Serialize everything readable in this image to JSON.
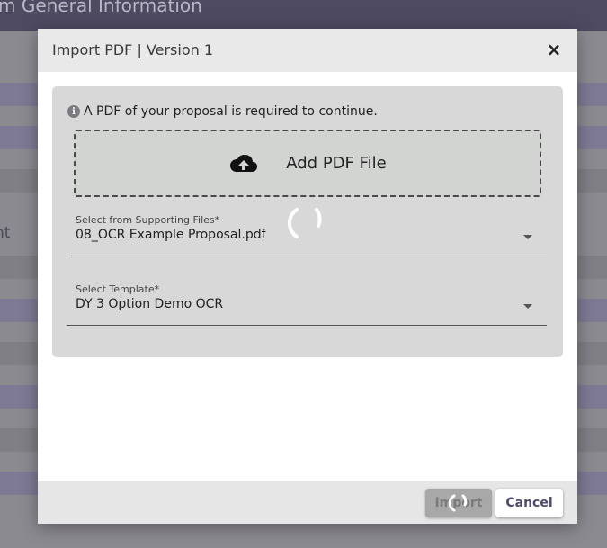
{
  "background": {
    "page_title_fragment": "m General Information",
    "side_text_fragment": "nt"
  },
  "modal": {
    "title": "Import PDF | Version 1",
    "close_label": "×",
    "notice": "A PDF of your proposal is required to continue.",
    "info_icon_glyph": "i",
    "dropzone_label": "Add PDF File",
    "supporting_files": {
      "label": "Select from Supporting Files*",
      "value": "08_OCR Example Proposal.pdf"
    },
    "template": {
      "label": "Select Template*",
      "value": "DY 3 Option Demo OCR"
    },
    "footer": {
      "import_label": "Import",
      "cancel_label": "Cancel"
    }
  },
  "colors": {
    "header_bg": "#4e4a62",
    "accent_text": "#4e4a6a",
    "card_bg": "#d8d8d8"
  },
  "icons": [
    "info-icon",
    "close-icon",
    "cloud-upload-icon",
    "caret-down-icon",
    "loading-spinner-icon"
  ]
}
